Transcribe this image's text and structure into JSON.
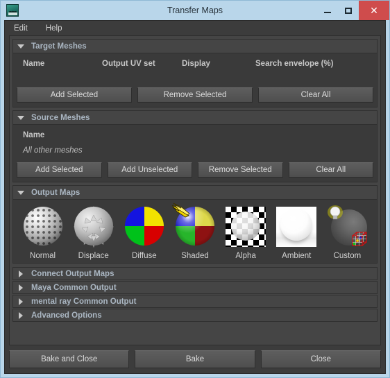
{
  "window": {
    "title": "Transfer Maps",
    "app_icon": "maya-icon",
    "controls": {
      "minimize": "minimize-icon",
      "maximize": "maximize-icon",
      "close": "✕"
    }
  },
  "menubar": {
    "items": [
      {
        "label": "Edit",
        "name": "menu-edit"
      },
      {
        "label": "Help",
        "name": "menu-help"
      }
    ]
  },
  "sections": {
    "target_meshes": {
      "title": "Target Meshes",
      "expanded": true,
      "columns": [
        "Name",
        "Output UV set",
        "Display",
        "Search envelope (%)"
      ],
      "rows": [],
      "buttons": [
        "Add Selected",
        "Remove Selected",
        "Clear All"
      ]
    },
    "source_meshes": {
      "title": "Source Meshes",
      "expanded": true,
      "columns": [
        "Name"
      ],
      "rows": [
        "All other meshes"
      ],
      "buttons": [
        "Add Selected",
        "Add Unselected",
        "Remove Selected",
        "Clear All"
      ]
    },
    "output_maps": {
      "title": "Output Maps",
      "expanded": true,
      "maps": [
        {
          "label": "Normal",
          "icon": "normal-map-icon"
        },
        {
          "label": "Displace",
          "icon": "displace-map-icon"
        },
        {
          "label": "Diffuse",
          "icon": "diffuse-map-icon"
        },
        {
          "label": "Shaded",
          "icon": "shaded-map-icon"
        },
        {
          "label": "Alpha",
          "icon": "alpha-map-icon"
        },
        {
          "label": "Ambient",
          "icon": "ambient-map-icon"
        },
        {
          "label": "Custom",
          "icon": "custom-map-icon"
        }
      ]
    },
    "collapsed": [
      {
        "title": "Connect Output Maps",
        "name": "section-connect-output-maps"
      },
      {
        "title": "Maya Common Output",
        "name": "section-maya-common-output"
      },
      {
        "title": "mental ray Common Output",
        "name": "section-mental-ray-common-output"
      },
      {
        "title": "Advanced Options",
        "name": "section-advanced-options"
      }
    ]
  },
  "footer": {
    "buttons": [
      "Bake and Close",
      "Bake",
      "Close"
    ]
  },
  "colors": {
    "titlebar": "#b9d6ea",
    "close_button": "#cf4c4c",
    "panel_bg": "#454545",
    "section_bg": "#3a3a3a",
    "menubar_bg": "#3c3c3c",
    "section_title": "#aab6c2",
    "text": "#d2d2d2"
  }
}
